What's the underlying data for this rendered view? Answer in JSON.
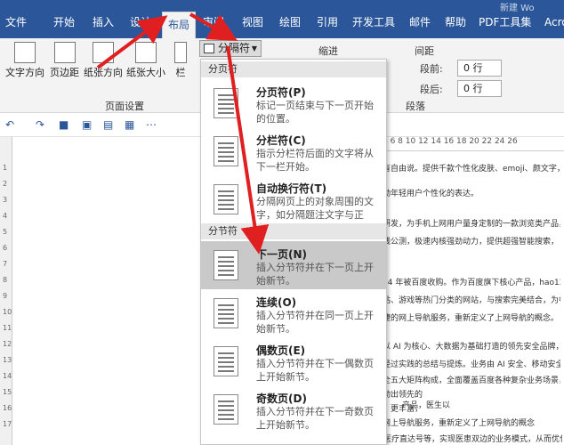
{
  "title_corner": "新建 Wo",
  "tabs": [
    "文件",
    "开始",
    "插入",
    "设计",
    "布局",
    "审阅",
    "视图",
    "绘图",
    "引用",
    "开发工具",
    "邮件",
    "帮助",
    "PDF工具集",
    "Acro"
  ],
  "ribbon": {
    "buttons": [
      "文字方向",
      "页边距",
      "纸张方向",
      "纸张大小",
      "栏"
    ],
    "group_page_setup": "页面设置",
    "separator_dropdown": "分隔符",
    "indent_label": "缩进",
    "spacing_label": "间距",
    "before_label": "段前:",
    "after_label": "段后:",
    "before_value": "0 行",
    "after_value": "0 行",
    "paragraph_group": "段落"
  },
  "menu": {
    "section_page": "分页符",
    "section_section": "分节符",
    "items": [
      {
        "title": "分页符(P)",
        "desc": "标记一页结束与下一页开始的位置。"
      },
      {
        "title": "分栏符(C)",
        "desc": "指示分栏符后面的文字将从下一栏开始。"
      },
      {
        "title": "自动换行符(T)",
        "desc": "分隔网页上的对象周围的文字，如分隔题注文字与正文。"
      },
      {
        "title": "下一页(N)",
        "desc": "插入分节符并在下一页上开始新节。"
      },
      {
        "title": "连续(O)",
        "desc": "插入分节符并在同一页上开始新节。"
      },
      {
        "title": "偶数页(E)",
        "desc": "插入分节符并在下一偶数页上开始新节。"
      },
      {
        "title": "奇数页(D)",
        "desc": "插入分节符并在下一奇数页上开始新节。"
      }
    ]
  },
  "doc_lines": [
    "有自由说。提供千款个性化皮肤、emoji、颜文字，热",
    "勤年轻用户个性化的表达。",
    "研发，为手机上网用户量身定制的一款浏览类产品，",
    "线公测，极速内核强劲动力，提供超强智能搜索，",
    "94 年被百度收购。作为百度旗下核心产品，hao123 及",
    "站、游戏等热门分类的网站，与搜索完美结合，为中",
    "捷的网上导航服务，重新定义了上网导航的概念。",
    "以 AI 为核心、大数据为基础打造的领先安全品牌，",
    "经过实践的总结与提炼。业务由 AI 安全、移动安全、",
    "全五大矩阵构成，全面覆盖百度各种复杂业务场景，",
    "动出领先的",
    "，更丰富，",
    "网上导航服务，重新定义了上网导航的概念",
    "产品，医生以",
    "医生工作台、百度医生、医疗直达号等，实现医患双边的业务模式，从而优化医"
  ],
  "ruler_v": [
    "1",
    "2",
    "3",
    "4",
    "5",
    "6",
    "7",
    "8",
    "9",
    "10",
    "11",
    "12",
    "13",
    "14",
    "15",
    "16",
    "17"
  ],
  "ruler_h": "4  6  8  10  12  14  16  18  20  22  24  26",
  "colors": {
    "ribbon_blue": "#2b579a",
    "arrow_red": "#e02020",
    "highlight": "#c9c9c9"
  }
}
